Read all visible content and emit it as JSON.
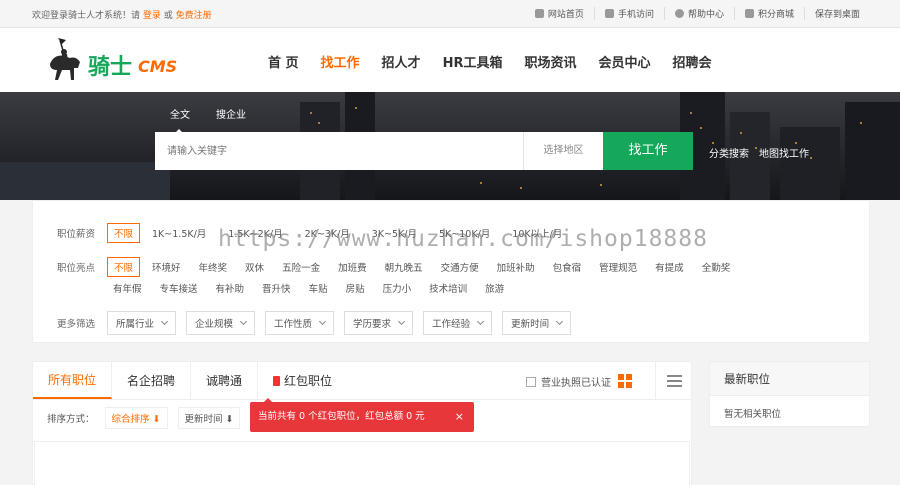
{
  "topbar": {
    "welcome_prefix": "欢迎登录骑士人才系统！请",
    "login": "登录",
    "or": "或",
    "register": "免费注册",
    "links": [
      {
        "label": "网站首页",
        "icon": "home-icon"
      },
      {
        "label": "手机访问",
        "icon": "mobile-icon"
      },
      {
        "label": "帮助中心",
        "icon": "help-icon"
      },
      {
        "label": "积分商城",
        "icon": "gift-icon"
      },
      {
        "label": "保存到桌面",
        "icon": ""
      }
    ]
  },
  "logo": {
    "text_cn": "骑士",
    "text_en": "CMS"
  },
  "nav": [
    {
      "label": "首 页",
      "active": false
    },
    {
      "label": "找工作",
      "active": true
    },
    {
      "label": "招人才",
      "active": false
    },
    {
      "label": "HR工具箱",
      "active": false
    },
    {
      "label": "职场资讯",
      "active": false
    },
    {
      "label": "会员中心",
      "active": false
    },
    {
      "label": "招聘会",
      "active": false
    }
  ],
  "search": {
    "tabs": [
      "全文",
      "搜企业"
    ],
    "placeholder": "请输入关键字",
    "area": "选择地区",
    "button": "找工作",
    "links": [
      "分类搜索",
      "地图找工作"
    ]
  },
  "filters": {
    "salary_label": "职位薪资",
    "salary_options": [
      "不限",
      "1K~1.5K/月",
      "1.5K~2K/月",
      "2K~3K/月",
      "3K~5K/月",
      "5K~10K/月",
      "10K以上/月"
    ],
    "highlight_label": "职位亮点",
    "highlight_row1": [
      "不限",
      "环境好",
      "年终奖",
      "双休",
      "五险一金",
      "加班费",
      "朝九晚五",
      "交通方便",
      "加班补助",
      "包食宿",
      "管理规范",
      "有提成",
      "全勤奖"
    ],
    "highlight_row2": [
      "有年假",
      "专车接送",
      "有补助",
      "晋升快",
      "车贴",
      "房贴",
      "压力小",
      "技术培训",
      "旅游"
    ],
    "more_label": "更多筛选",
    "dropdowns": [
      "所属行业",
      "企业规模",
      "工作性质",
      "学历要求",
      "工作经验",
      "更新时间"
    ]
  },
  "watermark": "https://www.huzhan.com/ishop18888",
  "main": {
    "tabs": [
      "所有职位",
      "名企招聘",
      "诚聘通",
      "红包职位"
    ],
    "license_check": "营业执照已认证",
    "sort_label": "排序方式：",
    "sort_options": [
      "综合排序 ⬇",
      "更新时间 ⬇"
    ]
  },
  "redtip": {
    "text": "当前共有 0 个红包职位，红包总额 0 元",
    "close": "×"
  },
  "side": {
    "title": "最新职位",
    "empty": "暂无相关职位"
  },
  "colors": {
    "accent": "#ff6a00",
    "search_button": "#15a85a",
    "redtip": "#e8373a"
  }
}
